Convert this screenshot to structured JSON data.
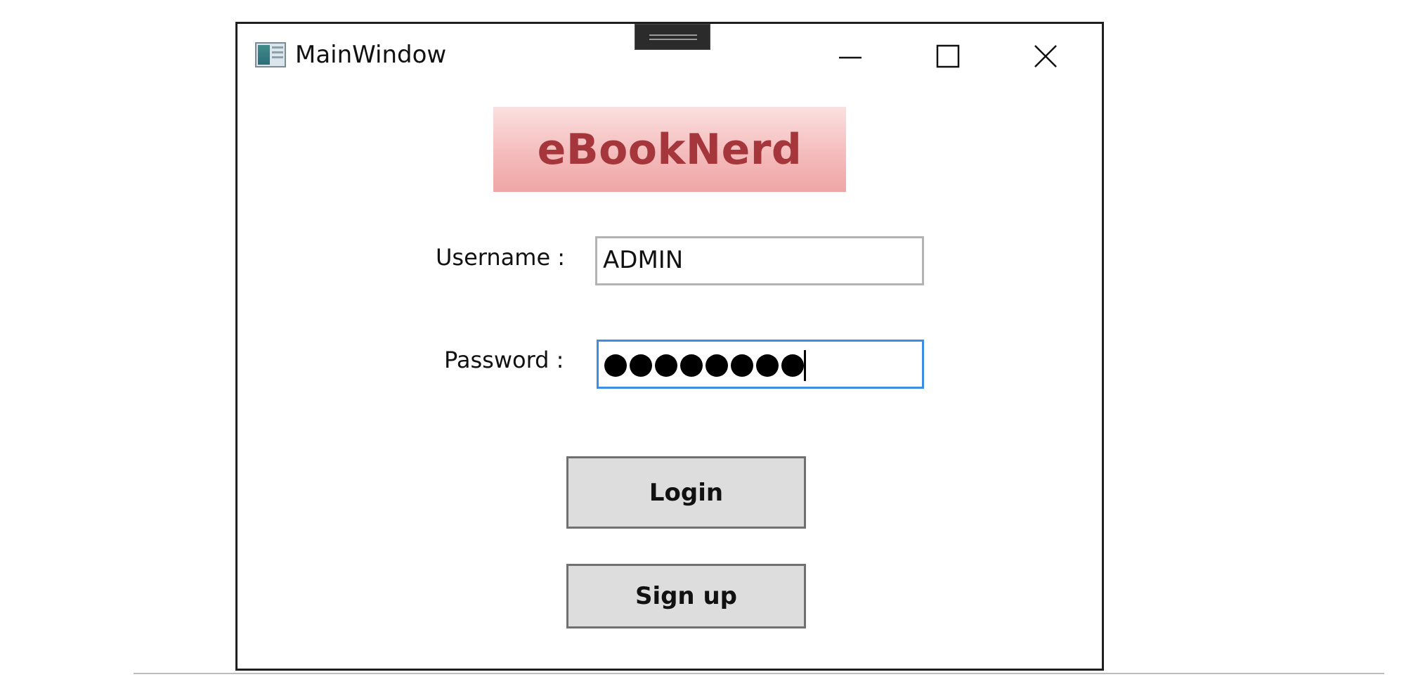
{
  "window": {
    "title": "MainWindow",
    "icon": "app-window-icon",
    "controls": {
      "minimize_icon": "minimize-icon",
      "maximize_icon": "maximize-icon",
      "close_icon": "close-icon"
    }
  },
  "banner": {
    "text": "eBookNerd",
    "text_color": "#a5363b",
    "background_color": "#f4b9b9"
  },
  "form": {
    "username_label": "Username :",
    "username_value": "ADMIN",
    "password_label": "Password :",
    "password_mask_count": 8,
    "password_focus_color": "#3d8ee3"
  },
  "buttons": {
    "login_label": "Login",
    "signup_label": "Sign up"
  }
}
